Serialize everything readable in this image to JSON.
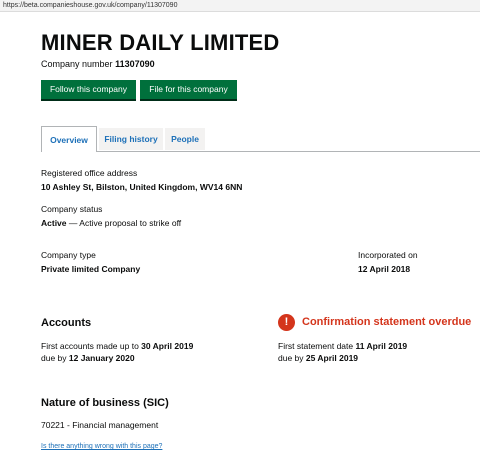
{
  "browser": {
    "url": "https://beta.companieshouse.gov.uk/company/11307090"
  },
  "company": {
    "name": "MINER DAILY LIMITED",
    "number_label": "Company number",
    "number": "11307090"
  },
  "actions": {
    "follow_label": "Follow this company",
    "file_label": "File for this company"
  },
  "tabs": [
    {
      "label": "Overview",
      "active": true
    },
    {
      "label": "Filing history",
      "active": false
    },
    {
      "label": "People",
      "active": false
    }
  ],
  "overview": {
    "address_label": "Registered office address",
    "address_value": "10 Ashley St, Bilston, United Kingdom, WV14 6NN",
    "status_label": "Company status",
    "status_value": "Active",
    "status_detail": " — Active proposal to strike off",
    "type_label": "Company type",
    "type_value": "Private limited Company",
    "incorporated_label": "Incorporated on",
    "incorporated_value": "12 April 2018"
  },
  "accounts": {
    "heading": "Accounts",
    "made_up_prefix": "First accounts made up to ",
    "made_up_date": "30 April 2019",
    "due_prefix": "due by ",
    "due_date": "12 January 2020"
  },
  "confirmation": {
    "alert_icon": "!",
    "heading": "Confirmation statement overdue",
    "statement_prefix": "First statement date ",
    "statement_date": "11 April 2019",
    "due_prefix": "due by ",
    "due_date": "25 April 2019"
  },
  "sic": {
    "heading": "Nature of business (SIC)",
    "code": "70221",
    "description": " - Financial management"
  },
  "footer": {
    "feedback_link": "Is there anything wrong with this page?"
  },
  "colors": {
    "button_green": "#00703c",
    "link_blue": "#1d70b8",
    "alert_red": "#d4351c"
  }
}
